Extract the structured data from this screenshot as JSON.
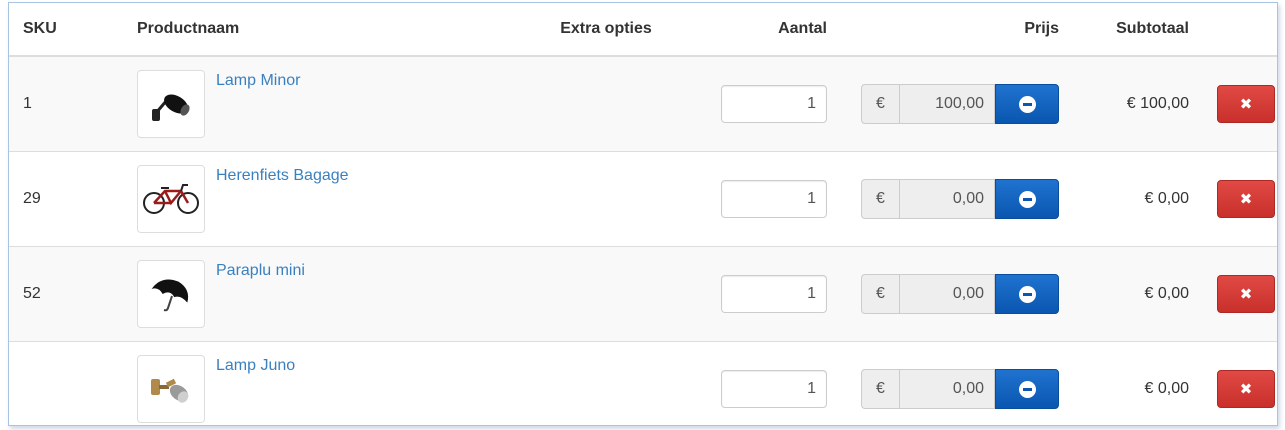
{
  "table": {
    "headers": {
      "sku": "SKU",
      "name": "Productnaam",
      "options": "Extra opties",
      "qty": "Aantal",
      "price": "Prijs",
      "subtotal": "Subtotaal"
    },
    "currency_symbol": "€",
    "rows": [
      {
        "sku": "1",
        "name": "Lamp Minor",
        "qty": "1",
        "price": "100,00",
        "subtotal": "€ 100,00",
        "image_icon": "spot-lamp-icon"
      },
      {
        "sku": "29",
        "name": "Herenfiets Bagage",
        "qty": "1",
        "price": "0,00",
        "subtotal": "€ 0,00",
        "image_icon": "bicycle-icon"
      },
      {
        "sku": "52",
        "name": "Paraplu mini",
        "qty": "1",
        "price": "0,00",
        "subtotal": "€ 0,00",
        "image_icon": "umbrella-icon"
      },
      {
        "sku": "",
        "name": "Lamp Juno",
        "qty": "1",
        "price": "0,00",
        "subtotal": "€ 0,00",
        "image_icon": "wall-lamp-icon"
      }
    ]
  },
  "colors": {
    "link": "#3a80bf",
    "primary_button": "#0a56b0",
    "danger_button": "#d9534f"
  }
}
